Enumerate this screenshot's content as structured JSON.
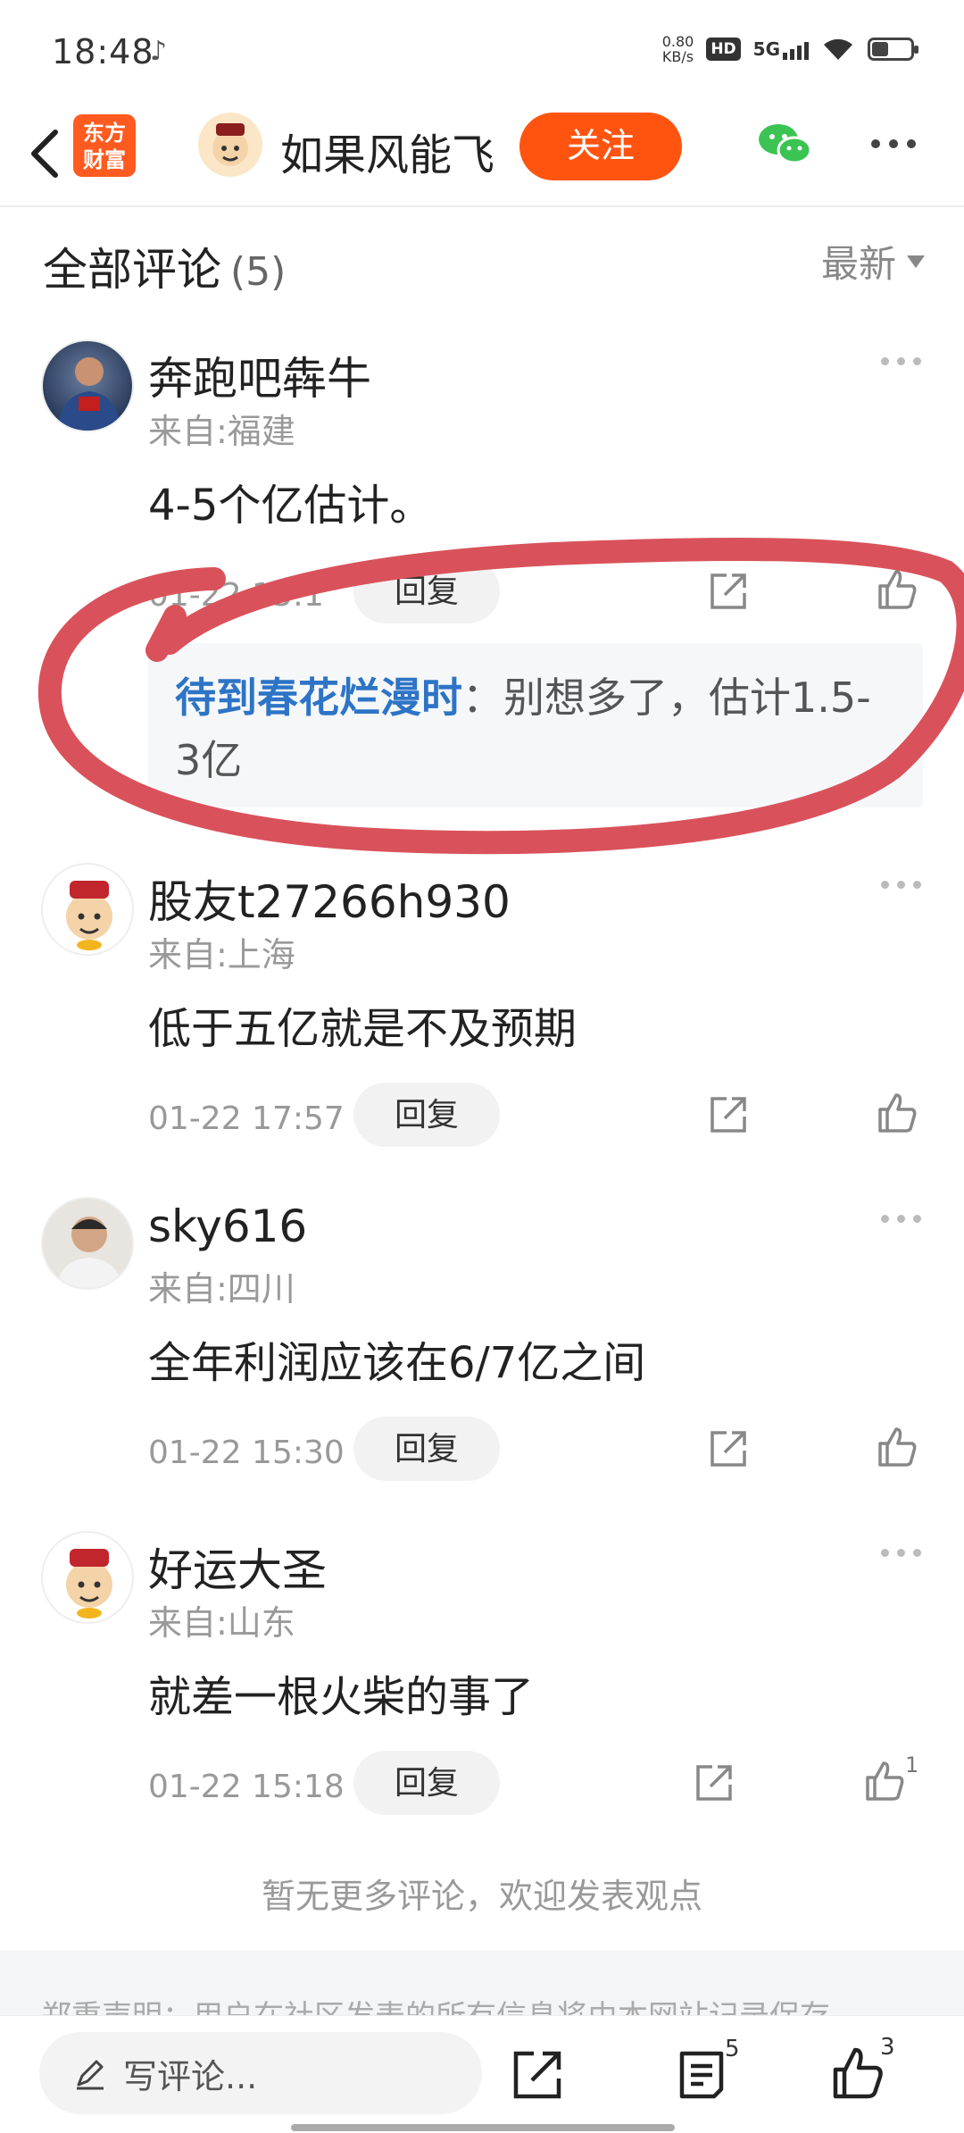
{
  "status_bar": {
    "time": "18:48",
    "net_speed_value": "0.80",
    "net_speed_unit": "KB/s",
    "hd": "HD",
    "network": "5G",
    "battery_level": 0.4
  },
  "nav": {
    "brand_logo": "东方\n财富",
    "author_name": "如果风能飞",
    "follow_label": "关注"
  },
  "comments_header": {
    "title": "全部评论",
    "count": "(5)",
    "sort_label": "最新"
  },
  "comments": [
    {
      "name": "奔跑吧犇牛",
      "location": "来自:福建",
      "text": "4-5个亿估计。",
      "time": "01-22 15:1",
      "reply_label": "回复",
      "sub_reply": {
        "user": "待到春花烂漫时",
        "text": "：别想多了，估计1.5-3亿"
      }
    },
    {
      "name": "股友t27266h930",
      "location": "来自:上海",
      "text": "低于五亿就是不及预期",
      "time": "01-22 17:57",
      "reply_label": "回复"
    },
    {
      "name": "sky616",
      "location": "来自:四川",
      "text": "全年利润应该在6/7亿之间",
      "time": "01-22 15:30",
      "reply_label": "回复"
    },
    {
      "name": "好运大圣",
      "location": "来自:山东",
      "text": "就差一根火柴的事了",
      "time": "01-22 15:18",
      "reply_label": "回复",
      "likes": "1"
    }
  ],
  "no_more_text": "暂无更多评论，欢迎发表观点",
  "disclaimer": "郑重声明：用户在社区发表的所有信息将由本网站记录保存",
  "bottom_bar": {
    "write_placeholder": "写评论...",
    "comment_count": "5",
    "like_count": "3"
  },
  "colors": {
    "accent": "#ff5410",
    "link_blue": "#2d74c6",
    "highlight_red": "#d9525b"
  }
}
